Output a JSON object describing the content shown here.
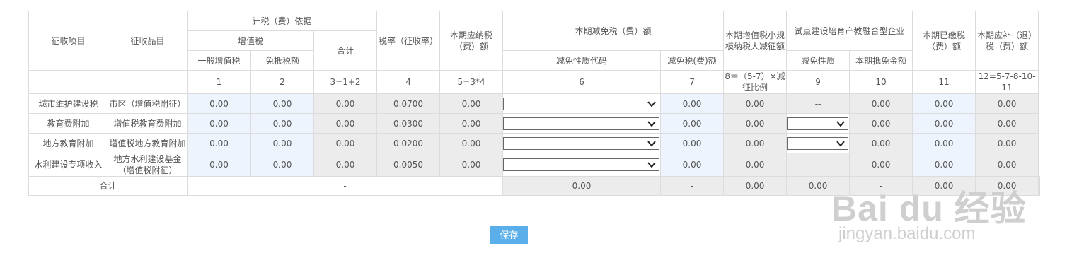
{
  "headers": {
    "item": "征收项目",
    "subitem": "征收品目",
    "basis": "计税（费）依据",
    "vat": "增值税",
    "general_vat": "一般增值税",
    "exempt_amount": "免抵税额",
    "subtotal": "合计",
    "rate": "税率（征收率）",
    "payable": "本期应纳税（费）额",
    "reduction": "本期减免税（费）额",
    "reduction_code": "减免性质代码",
    "reduction_amount": "减免税(费)额",
    "small_scale": "本期增值税小规模纳税人减征额",
    "pilot": "试点建设培育产教融合型企业",
    "pilot_nature": "减免性质",
    "pilot_credit": "本期抵免金额",
    "paid": "本期已缴税（费）额",
    "refund": "本期应补（退）税（费）额"
  },
  "col_numbers": [
    "1",
    "2",
    "3=1+2",
    "4",
    "5=3*4",
    "6",
    "7",
    "8＝（5-7）×减征比例",
    "9",
    "10",
    "11",
    "12=5-7-8-10-11"
  ],
  "rows": [
    {
      "item": "城市维护建设税",
      "subitem": "市区（增值税附征）",
      "general_vat": "0.00",
      "exempt": "0.00",
      "subtotal": "0.00",
      "rate": "0.0700",
      "payable": "0.00",
      "reduction_amount": "0.00",
      "small_scale": "0.00",
      "pilot_nature": "--",
      "pilot_credit": "0.00",
      "paid": "0.00",
      "refund": "0.00"
    },
    {
      "item": "教育费附加",
      "subitem": "增值税教育费附加",
      "general_vat": "0.00",
      "exempt": "0.00",
      "subtotal": "0.00",
      "rate": "0.0300",
      "payable": "0.00",
      "reduction_amount": "0.00",
      "small_scale": "0.00",
      "pilot_nature": "",
      "pilot_credit": "0.00",
      "paid": "0.00",
      "refund": "0.00"
    },
    {
      "item": "地方教育附加",
      "subitem": "增值税地方教育附加",
      "general_vat": "0.00",
      "exempt": "0.00",
      "subtotal": "0.00",
      "rate": "0.0200",
      "payable": "0.00",
      "reduction_amount": "0.00",
      "small_scale": "0.00",
      "pilot_nature": "",
      "pilot_credit": "0.00",
      "paid": "0.00",
      "refund": "0.00"
    },
    {
      "item": "水利建设专项收入",
      "subitem": "地方水利建设基金（增值税附征）",
      "general_vat": "0.00",
      "exempt": "0.00",
      "subtotal": "0.00",
      "rate": "0.0050",
      "payable": "0.00",
      "reduction_amount": "0.00",
      "small_scale": "0.00",
      "pilot_nature": "--",
      "pilot_credit": "0.00",
      "paid": "0.00",
      "refund": "0.00"
    }
  ],
  "total": {
    "label": "合计",
    "basis": "-",
    "payable": "0.00",
    "code": "-",
    "reduction_amount": "0.00",
    "small_scale": "0.00",
    "pilot_nature": "-",
    "pilot_credit": "0.00",
    "paid": "0.00",
    "refund": "0.00"
  },
  "save_label": "保存",
  "watermark": {
    "brand": "Bai du 经验",
    "url": "jingyan.baidu.com"
  },
  "icons": {
    "dropdown": "chevron-down-icon"
  }
}
